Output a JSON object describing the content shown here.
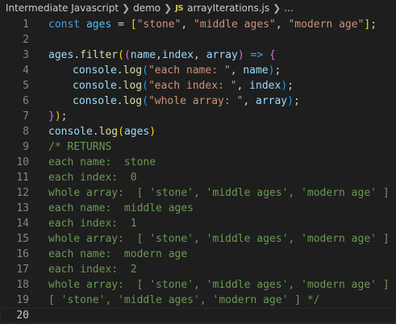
{
  "breadcrumb": {
    "folder1": "Intermediate Javascript",
    "folder2": "demo",
    "file_badge": "JS",
    "file": "arrayIterations.js",
    "more": "..."
  },
  "lines": [
    {
      "n": "1",
      "tokens": [
        {
          "t": "const",
          "c": "kw"
        },
        {
          "t": " ",
          "c": ""
        },
        {
          "t": "ages",
          "c": "var"
        },
        {
          "t": " = ",
          "c": "op"
        },
        {
          "t": "[",
          "c": "br1"
        },
        {
          "t": "\"stone\"",
          "c": "str"
        },
        {
          "t": ", ",
          "c": "op"
        },
        {
          "t": "\"middle ages\"",
          "c": "str"
        },
        {
          "t": ", ",
          "c": "op"
        },
        {
          "t": "\"modern age\"",
          "c": "str"
        },
        {
          "t": "]",
          "c": "br1"
        },
        {
          "t": ";",
          "c": "op"
        }
      ]
    },
    {
      "n": "2",
      "tokens": []
    },
    {
      "n": "3",
      "tokens": [
        {
          "t": "ages",
          "c": "prm"
        },
        {
          "t": ".",
          "c": "op"
        },
        {
          "t": "filter",
          "c": "fn"
        },
        {
          "t": "(",
          "c": "br1"
        },
        {
          "t": "(",
          "c": "br2"
        },
        {
          "t": "name",
          "c": "prm"
        },
        {
          "t": ",",
          "c": "op"
        },
        {
          "t": "index",
          "c": "prm"
        },
        {
          "t": ", ",
          "c": "op"
        },
        {
          "t": "array",
          "c": "prm"
        },
        {
          "t": ")",
          "c": "br2"
        },
        {
          "t": " ",
          "c": ""
        },
        {
          "t": "=>",
          "c": "kw"
        },
        {
          "t": " ",
          "c": ""
        },
        {
          "t": "{",
          "c": "br2"
        }
      ]
    },
    {
      "n": "4",
      "indent": true,
      "tokens": [
        {
          "t": "console",
          "c": "prm"
        },
        {
          "t": ".",
          "c": "op"
        },
        {
          "t": "log",
          "c": "fn"
        },
        {
          "t": "(",
          "c": "br3"
        },
        {
          "t": "\"each name: \"",
          "c": "str"
        },
        {
          "t": ", ",
          "c": "op"
        },
        {
          "t": "name",
          "c": "prm"
        },
        {
          "t": ")",
          "c": "br3"
        },
        {
          "t": ";",
          "c": "op"
        }
      ]
    },
    {
      "n": "5",
      "indent": true,
      "tokens": [
        {
          "t": "console",
          "c": "prm"
        },
        {
          "t": ".",
          "c": "op"
        },
        {
          "t": "log",
          "c": "fn"
        },
        {
          "t": "(",
          "c": "br3"
        },
        {
          "t": "\"each index: \"",
          "c": "str"
        },
        {
          "t": ", ",
          "c": "op"
        },
        {
          "t": "index",
          "c": "prm"
        },
        {
          "t": ")",
          "c": "br3"
        },
        {
          "t": ";",
          "c": "op"
        }
      ]
    },
    {
      "n": "6",
      "indent": true,
      "tokens": [
        {
          "t": "console",
          "c": "prm"
        },
        {
          "t": ".",
          "c": "op"
        },
        {
          "t": "log",
          "c": "fn"
        },
        {
          "t": "(",
          "c": "br3"
        },
        {
          "t": "\"whole array: \"",
          "c": "str"
        },
        {
          "t": ", ",
          "c": "op"
        },
        {
          "t": "array",
          "c": "prm"
        },
        {
          "t": ")",
          "c": "br3"
        },
        {
          "t": ";",
          "c": "op"
        }
      ]
    },
    {
      "n": "7",
      "tokens": [
        {
          "t": "}",
          "c": "br2"
        },
        {
          "t": ")",
          "c": "br1"
        },
        {
          "t": ";",
          "c": "op"
        }
      ]
    },
    {
      "n": "8",
      "tokens": [
        {
          "t": "console",
          "c": "prm"
        },
        {
          "t": ".",
          "c": "op"
        },
        {
          "t": "log",
          "c": "fn"
        },
        {
          "t": "(",
          "c": "br1"
        },
        {
          "t": "ages",
          "c": "prm"
        },
        {
          "t": ")",
          "c": "br1"
        }
      ]
    },
    {
      "n": "9",
      "tokens": [
        {
          "t": "/* RETURNS",
          "c": "cmt"
        }
      ]
    },
    {
      "n": "10",
      "tokens": [
        {
          "t": "each name:  stone",
          "c": "cmt"
        }
      ]
    },
    {
      "n": "11",
      "tokens": [
        {
          "t": "each index:  0",
          "c": "cmt"
        }
      ]
    },
    {
      "n": "12",
      "tokens": [
        {
          "t": "whole array:  [ 'stone', 'middle ages', 'modern age' ]",
          "c": "cmt"
        }
      ]
    },
    {
      "n": "13",
      "tokens": [
        {
          "t": "each name:  middle ages",
          "c": "cmt"
        }
      ]
    },
    {
      "n": "14",
      "tokens": [
        {
          "t": "each index:  1",
          "c": "cmt"
        }
      ]
    },
    {
      "n": "15",
      "tokens": [
        {
          "t": "whole array:  [ 'stone', 'middle ages', 'modern age' ]",
          "c": "cmt"
        }
      ]
    },
    {
      "n": "16",
      "tokens": [
        {
          "t": "each name:  modern age",
          "c": "cmt"
        }
      ]
    },
    {
      "n": "17",
      "tokens": [
        {
          "t": "each index:  2",
          "c": "cmt"
        }
      ]
    },
    {
      "n": "18",
      "tokens": [
        {
          "t": "whole array:  [ 'stone', 'middle ages', 'modern age' ]",
          "c": "cmt"
        }
      ]
    },
    {
      "n": "19",
      "tokens": [
        {
          "t": "[ 'stone', 'middle ages', 'modern age' ] */",
          "c": "cmt"
        }
      ]
    },
    {
      "n": "20",
      "current": true,
      "tokens": []
    }
  ],
  "colors": {
    "background": "#1e1e1e",
    "keyword": "#569cd6",
    "constant": "#4fc1ff",
    "variable": "#9cdcfe",
    "function": "#dcdcaa",
    "string": "#ce9178",
    "comment": "#6a9955",
    "bracket_1": "#ffd700",
    "bracket_2": "#da70d6",
    "bracket_3": "#179fff",
    "line_number": "#858585"
  }
}
